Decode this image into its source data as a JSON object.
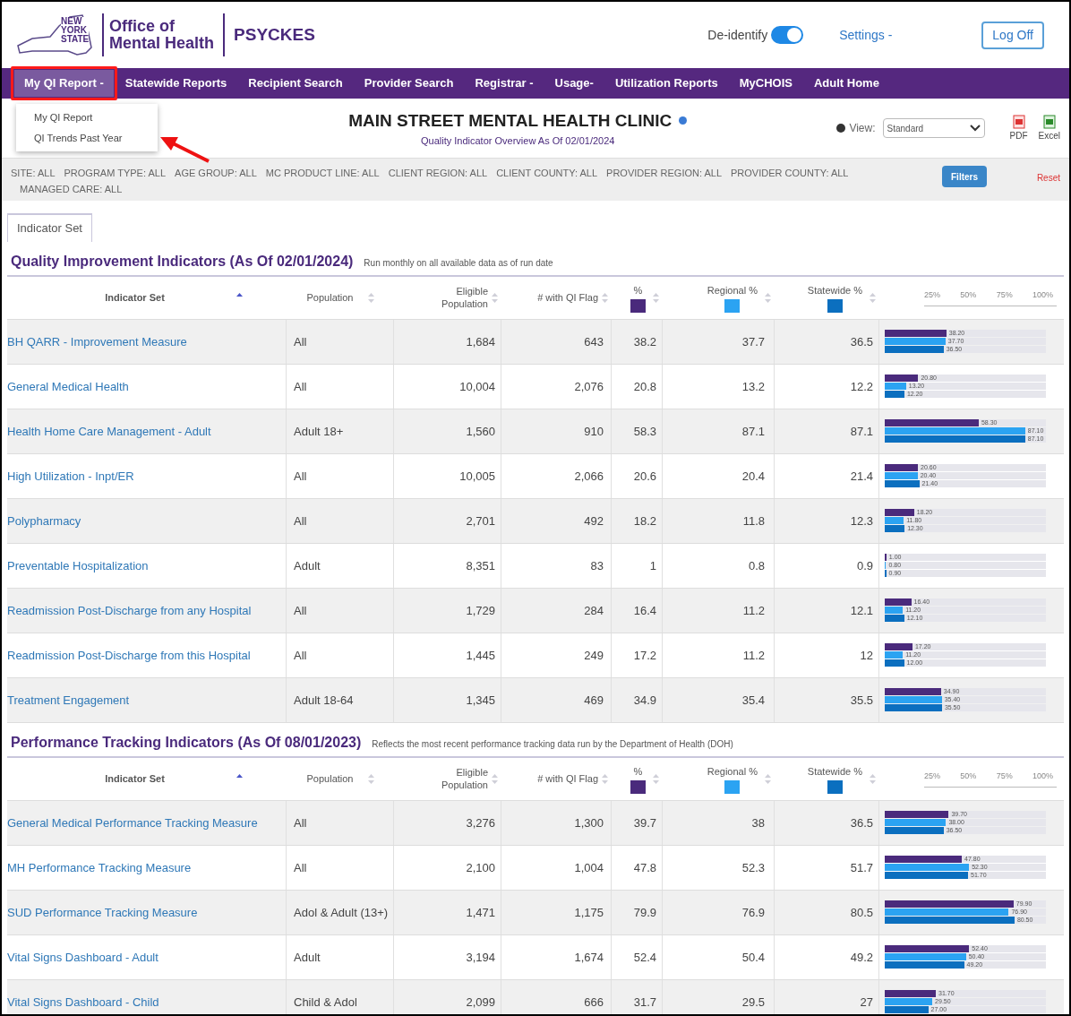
{
  "header": {
    "logo_lines": [
      "NEW",
      "YORK",
      "STATE"
    ],
    "org": [
      "Office of",
      "Mental Health"
    ],
    "app": "PSYCKES",
    "deidentify": {
      "label": "De-identify",
      "on": true
    },
    "settings": "Settings -",
    "logoff": "Log Off"
  },
  "nav": [
    {
      "label": "My QI Report -",
      "selected": true,
      "highlighted": true
    },
    {
      "label": "Statewide Reports",
      "selected": false,
      "highlighted": false
    },
    {
      "label": "Recipient Search",
      "selected": false,
      "highlighted": false
    },
    {
      "label": "Provider Search",
      "selected": false,
      "highlighted": false
    },
    {
      "label": "Registrar -",
      "selected": false,
      "highlighted": false
    },
    {
      "label": "Usage-",
      "selected": false,
      "highlighted": false
    },
    {
      "label": "Utilization Reports",
      "selected": false,
      "highlighted": false
    },
    {
      "label": "MyCHOIS",
      "selected": false,
      "highlighted": false
    },
    {
      "label": "Adult Home",
      "selected": false,
      "highlighted": false
    }
  ],
  "dropdown": {
    "items": [
      "My QI Report",
      "QI Trends Past Year"
    ]
  },
  "report": {
    "title": "MAIN STREET MENTAL HEALTH CLINIC",
    "subtitle": "Quality Indicator Overview As Of 02/01/2024",
    "view_label": "View:",
    "view_value": "Standard",
    "exports": [
      "PDF",
      "Excel"
    ]
  },
  "filters": {
    "items": [
      "SITE: ALL",
      "PROGRAM TYPE: ALL",
      "AGE GROUP: ALL",
      "MC PRODUCT LINE: ALL",
      "CLIENT REGION: ALL",
      "CLIENT COUNTY: ALL",
      "PROVIDER REGION: ALL",
      "PROVIDER COUNTY: ALL",
      "MANAGED CARE: ALL"
    ],
    "filters_button": "Filters",
    "reset": "Reset"
  },
  "tabs": [
    {
      "label": "Indicator Set",
      "selected": true
    }
  ],
  "sections": [
    {
      "title": "Quality Improvement Indicators (As Of 02/01/2024)",
      "note": "Run monthly on all available data as of run date",
      "columns": [
        "Indicator Set",
        "Population",
        "Eligible Population",
        "# with QI Flag",
        "%",
        "Regional %",
        "Statewide %"
      ],
      "axis_ticks": [
        "25%",
        "50%",
        "75%",
        "100%"
      ],
      "rows": [
        {
          "name": "BH QARR - Improvement Measure",
          "population": "All",
          "eligible": "1,684",
          "flagged": "643",
          "pct": "38.2",
          "regional": "37.7",
          "statewide": "36.5",
          "bars": [
            {
              "label": "38.20",
              "level": 0.382
            },
            {
              "label": "37.70",
              "level": 0.377
            },
            {
              "label": "36.50",
              "level": 0.365
            }
          ]
        },
        {
          "name": "General Medical Health",
          "population": "All",
          "eligible": "10,004",
          "flagged": "2,076",
          "pct": "20.8",
          "regional": "13.2",
          "statewide": "12.2",
          "bars": [
            {
              "label": "20.80",
              "level": 0.208
            },
            {
              "label": "13.20",
              "level": 0.132
            },
            {
              "label": "12.20",
              "level": 0.122
            }
          ]
        },
        {
          "name": "Health Home Care Management - Adult",
          "population": "Adult 18+",
          "eligible": "1,560",
          "flagged": "910",
          "pct": "58.3",
          "regional": "87.1",
          "statewide": "87.1",
          "bars": [
            {
              "label": "58.30",
              "level": 0.583
            },
            {
              "label": "87.10",
              "level": 0.871
            },
            {
              "label": "87.10",
              "level": 0.871
            }
          ]
        },
        {
          "name": "High Utilization - Inpt/ER",
          "population": "All",
          "eligible": "10,005",
          "flagged": "2,066",
          "pct": "20.6",
          "regional": "20.4",
          "statewide": "21.4",
          "bars": [
            {
              "label": "20.60",
              "level": 0.206
            },
            {
              "label": "20.40",
              "level": 0.204
            },
            {
              "label": "21.40",
              "level": 0.214
            }
          ]
        },
        {
          "name": "Polypharmacy",
          "population": "All",
          "eligible": "2,701",
          "flagged": "492",
          "pct": "18.2",
          "regional": "11.8",
          "statewide": "12.3",
          "bars": [
            {
              "label": "18.20",
              "level": 0.182
            },
            {
              "label": "11.80",
              "level": 0.118
            },
            {
              "label": "12.30",
              "level": 0.123
            }
          ]
        },
        {
          "name": "Preventable Hospitalization",
          "population": "Adult",
          "eligible": "8,351",
          "flagged": "83",
          "pct": "1",
          "regional": "0.8",
          "statewide": "0.9",
          "bars": [
            {
              "label": "1.00",
              "level": 0.01
            },
            {
              "label": "0.80",
              "level": 0.008
            },
            {
              "label": "0.90",
              "level": 0.009
            }
          ]
        },
        {
          "name": "Readmission Post-Discharge from any Hospital",
          "population": "All",
          "eligible": "1,729",
          "flagged": "284",
          "pct": "16.4",
          "regional": "11.2",
          "statewide": "12.1",
          "bars": [
            {
              "label": "16.40",
              "level": 0.164
            },
            {
              "label": "11.20",
              "level": 0.112
            },
            {
              "label": "12.10",
              "level": 0.121
            }
          ]
        },
        {
          "name": "Readmission Post-Discharge from this Hospital",
          "population": "All",
          "eligible": "1,445",
          "flagged": "249",
          "pct": "17.2",
          "regional": "11.2",
          "statewide": "12",
          "bars": [
            {
              "label": "17.20",
              "level": 0.172
            },
            {
              "label": "11.20",
              "level": 0.112
            },
            {
              "label": "12.00",
              "level": 0.12
            }
          ]
        },
        {
          "name": "Treatment Engagement",
          "population": "Adult 18-64",
          "eligible": "1,345",
          "flagged": "469",
          "pct": "34.9",
          "regional": "35.4",
          "statewide": "35.5",
          "bars": [
            {
              "label": "34.90",
              "level": 0.349
            },
            {
              "label": "35.40",
              "level": 0.354
            },
            {
              "label": "35.50",
              "level": 0.355
            }
          ]
        }
      ]
    },
    {
      "title": "Performance Tracking Indicators (As Of 08/01/2023)",
      "note": "Reflects the most recent performance tracking data run by the Department of Health (DOH)",
      "columns": [
        "Indicator Set",
        "Population",
        "Eligible Population",
        "# with QI Flag",
        "%",
        "Regional %",
        "Statewide %"
      ],
      "axis_ticks": [
        "25%",
        "50%",
        "75%",
        "100%"
      ],
      "rows": [
        {
          "name": "General Medical Performance Tracking Measure",
          "population": "All",
          "eligible": "3,276",
          "flagged": "1,300",
          "pct": "39.7",
          "regional": "38",
          "statewide": "36.5",
          "bars": [
            {
              "label": "39.70",
              "level": 0.397
            },
            {
              "label": "38.00",
              "level": 0.38
            },
            {
              "label": "36.50",
              "level": 0.365
            }
          ]
        },
        {
          "name": "MH Performance Tracking Measure",
          "population": "All",
          "eligible": "2,100",
          "flagged": "1,004",
          "pct": "47.8",
          "regional": "52.3",
          "statewide": "51.7",
          "bars": [
            {
              "label": "47.80",
              "level": 0.478
            },
            {
              "label": "52.30",
              "level": 0.523
            },
            {
              "label": "51.70",
              "level": 0.517
            }
          ]
        },
        {
          "name": "SUD Performance Tracking Measure",
          "population": "Adol & Adult (13+)",
          "eligible": "1,471",
          "flagged": "1,175",
          "pct": "79.9",
          "regional": "76.9",
          "statewide": "80.5",
          "bars": [
            {
              "label": "79.90",
              "level": 0.799
            },
            {
              "label": "76.90",
              "level": 0.769
            },
            {
              "label": "80.50",
              "level": 0.805
            }
          ]
        },
        {
          "name": "Vital Signs Dashboard - Adult",
          "population": "Adult",
          "eligible": "3,194",
          "flagged": "1,674",
          "pct": "52.4",
          "regional": "50.4",
          "statewide": "49.2",
          "bars": [
            {
              "label": "52.40",
              "level": 0.524
            },
            {
              "label": "50.40",
              "level": 0.504
            },
            {
              "label": "49.20",
              "level": 0.492
            }
          ]
        },
        {
          "name": "Vital Signs Dashboard - Child",
          "population": "Child & Adol",
          "eligible": "2,099",
          "flagged": "666",
          "pct": "31.7",
          "regional": "29.5",
          "statewide": "27",
          "bars": [
            {
              "label": "31.70",
              "level": 0.317
            },
            {
              "label": "29.50",
              "level": 0.295
            },
            {
              "label": "27.00",
              "level": 0.27
            }
          ]
        }
      ]
    }
  ]
}
